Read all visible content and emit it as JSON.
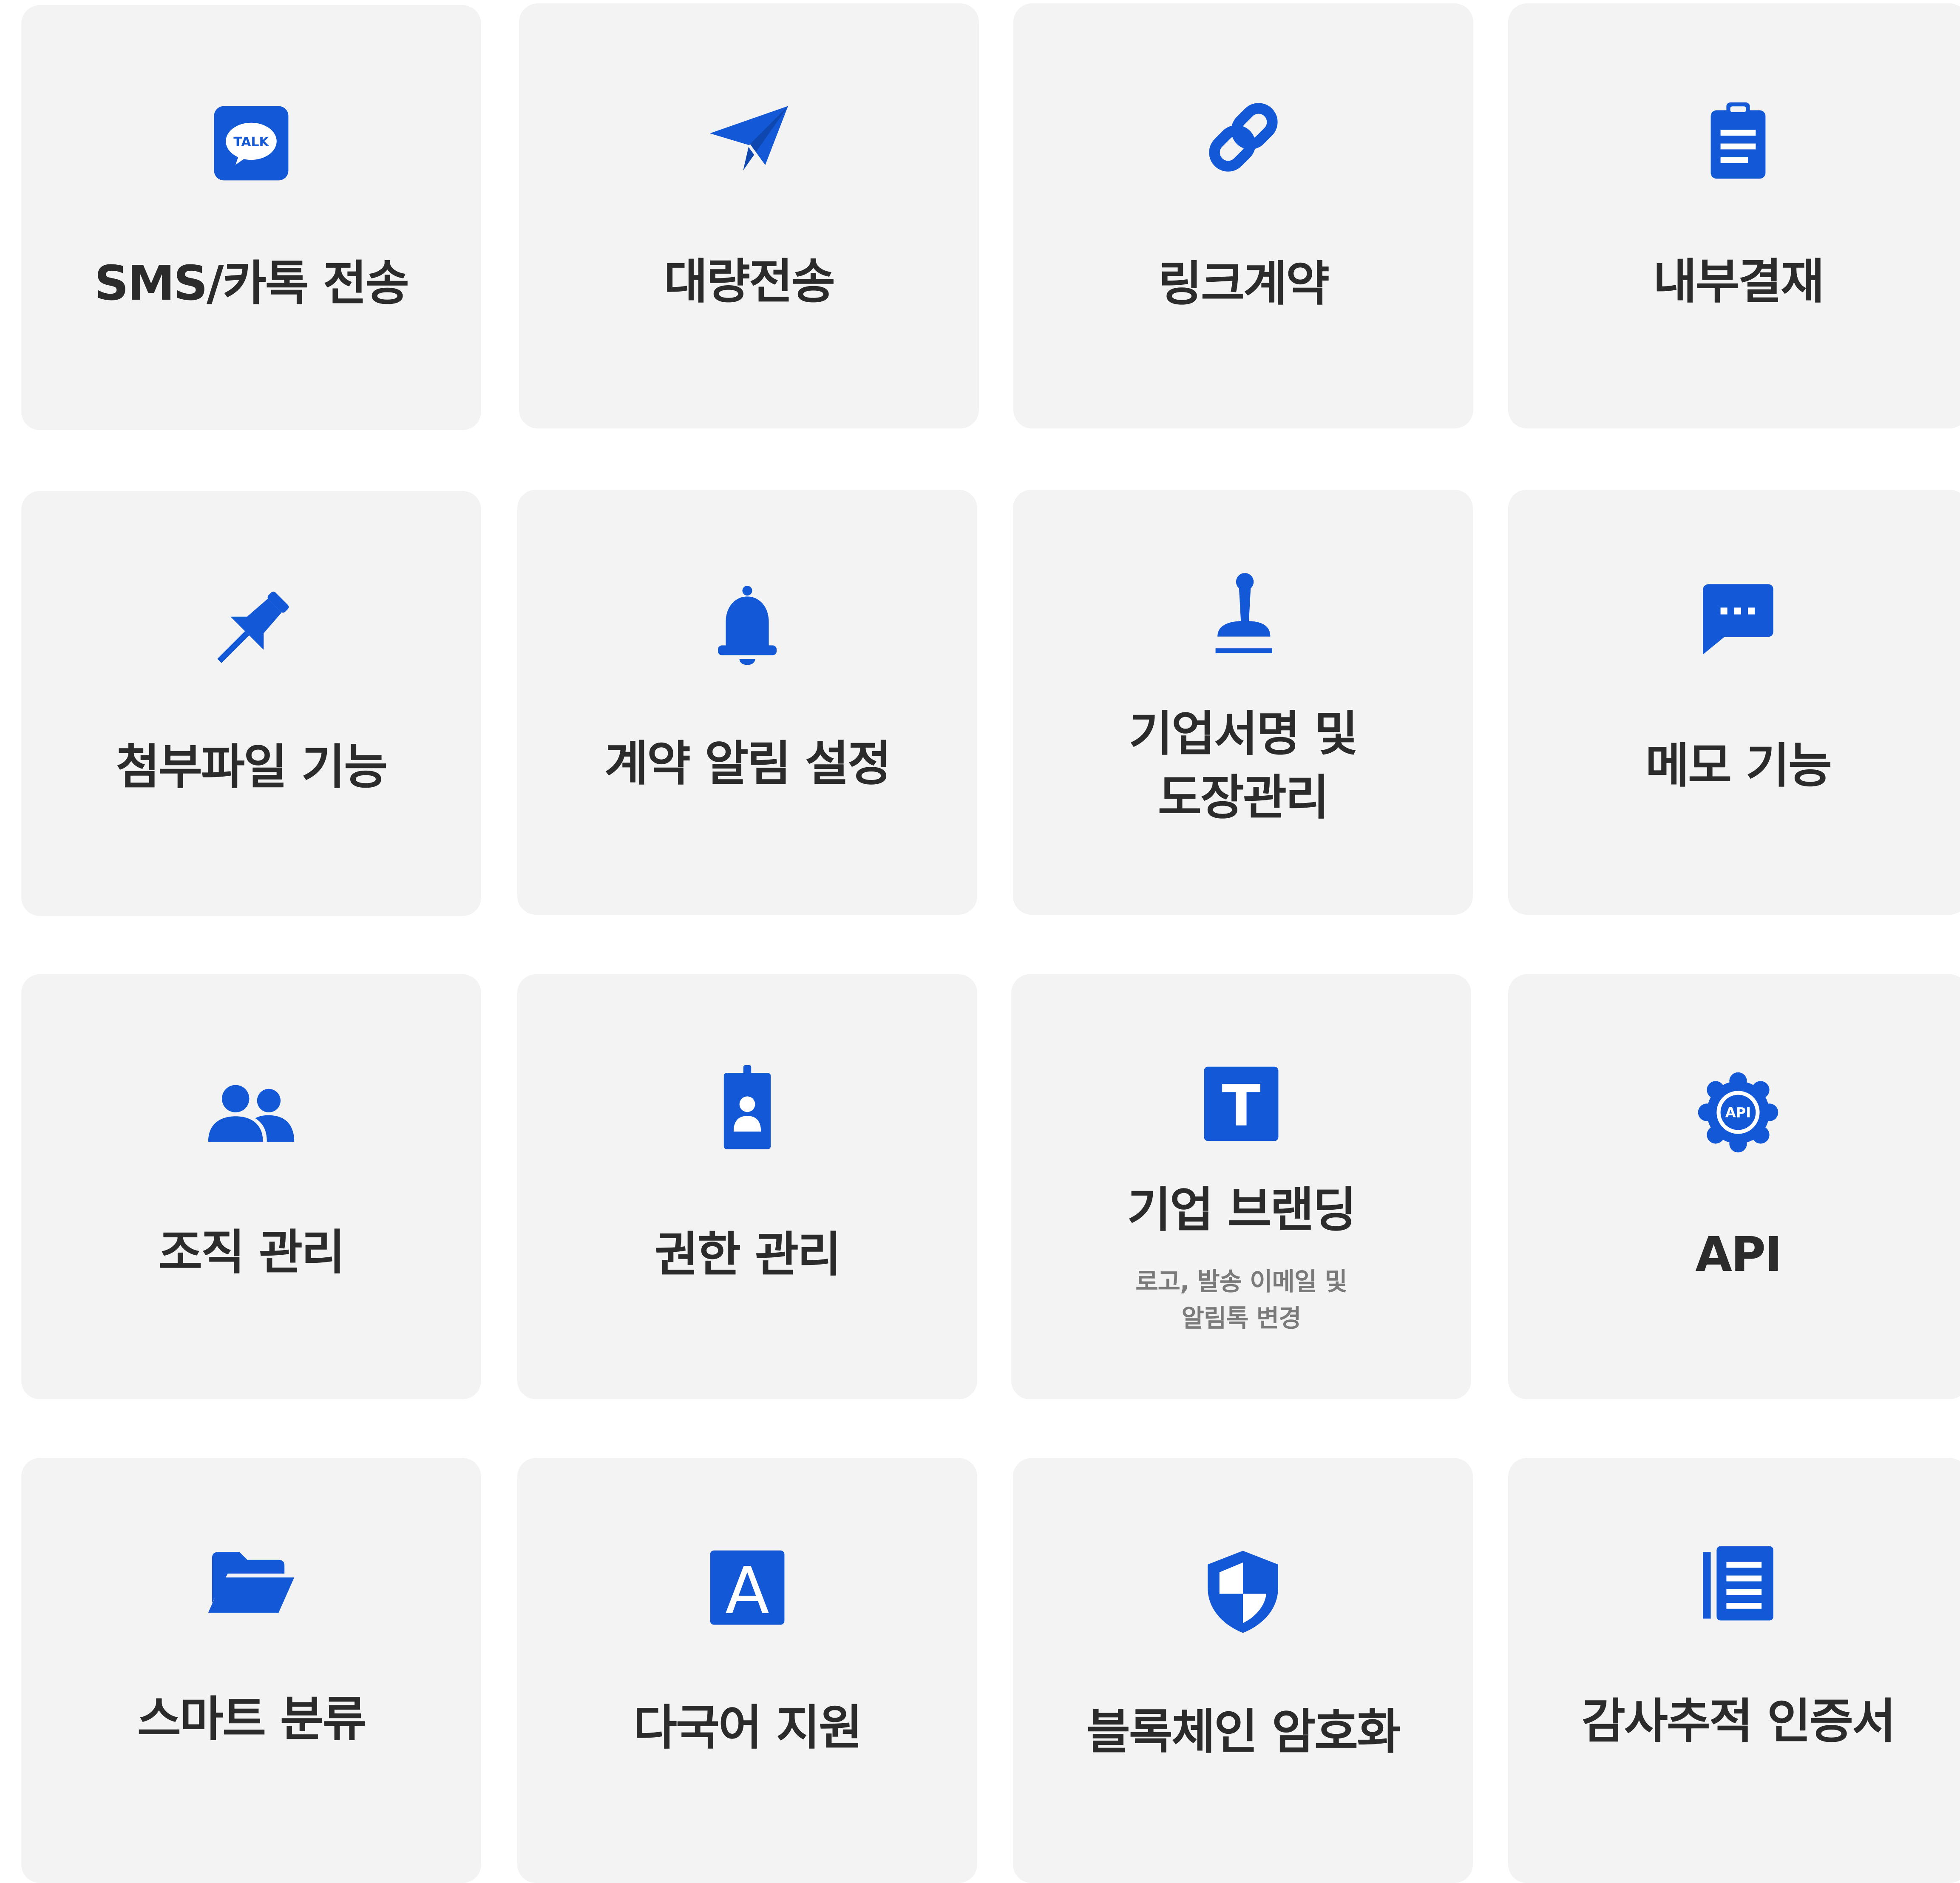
{
  "accent_color": "#1358d6",
  "cards": [
    {
      "icon": "kakao-talk-icon",
      "label": "SMS/카톡 전송",
      "talk_text": "TALK"
    },
    {
      "icon": "paper-plane-icon",
      "label": "대량전송"
    },
    {
      "icon": "link-icon",
      "label": "링크계약"
    },
    {
      "icon": "clipboard-icon",
      "label": "내부결재"
    },
    {
      "icon": "pushpin-icon",
      "label": "첨부파일 기능"
    },
    {
      "icon": "bell-icon",
      "label": "계약 알림 설정"
    },
    {
      "icon": "stamp-icon",
      "label": "기업서명 및\n도장관리"
    },
    {
      "icon": "chat-bubble-icon",
      "label": "메모 기능"
    },
    {
      "icon": "users-icon",
      "label": "조직 관리"
    },
    {
      "icon": "id-badge-icon",
      "label": "권한 관리"
    },
    {
      "icon": "text-t-icon",
      "label": "기업 브랜딩",
      "sublabel": "로고, 발송 이메일 및\n알림톡 변경",
      "glyph": "T"
    },
    {
      "icon": "api-gear-icon",
      "label": "API",
      "glyph": "API"
    },
    {
      "icon": "folder-open-icon",
      "label": "스마트 분류"
    },
    {
      "icon": "language-a-icon",
      "label": "다국어 지원",
      "glyph": "A"
    },
    {
      "icon": "shield-icon",
      "label": "블록체인 암호화"
    },
    {
      "icon": "list-document-icon",
      "label": "감사추적 인증서"
    }
  ]
}
